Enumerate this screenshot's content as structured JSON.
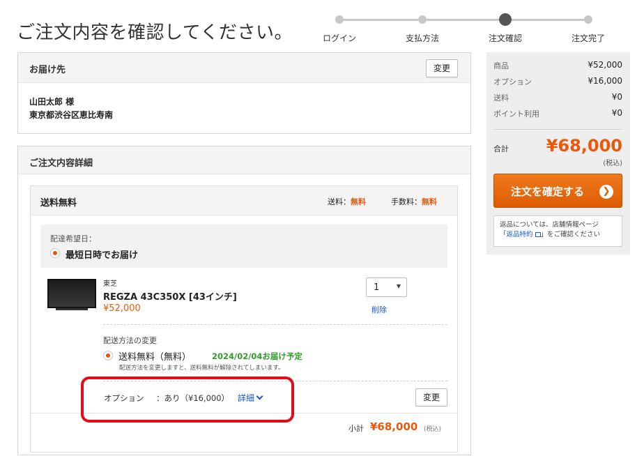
{
  "page_title": "ご注文内容を確認してください。",
  "progress": {
    "steps": [
      "ログイン",
      "支払方法",
      "注文確認",
      "注文完了"
    ],
    "current_index": 2
  },
  "delivery_address": {
    "title": "お届け先",
    "change_label": "変更",
    "name": "山田太郎 様",
    "address": "東京都渋谷区恵比寿南"
  },
  "order_detail": {
    "title": "ご注文内容詳細",
    "shipping_group": {
      "title": "送料無料",
      "shipping_fee_label": "送料：",
      "shipping_fee_value": "無料",
      "handling_fee_label": "手数料：",
      "handling_fee_value": "無料",
      "delivery_date_label": "配達希望日：",
      "delivery_date_option": "最短日時でお届け"
    },
    "item": {
      "brand": "東芝",
      "name": "REGZA 43C350X [43インチ]",
      "price": "¥52,000",
      "quantity": "1",
      "delete_label": "削除"
    },
    "shipping_method": {
      "label": "配送方法の変更",
      "option": "送料無料（無料）",
      "eta": "2024/02/04お届け予定",
      "note": "配送方法を変更しますと、送料無料が解除されてしまいます。"
    },
    "option_row": {
      "label": "オプション",
      "value": "：あり（¥16,000）",
      "detail_link": "詳細",
      "change_label": "変更"
    },
    "subtotal": {
      "label": "小計",
      "value": "¥68,000",
      "tax_note": "(税込)"
    }
  },
  "summary": {
    "rows": [
      {
        "label": "商品",
        "value": "¥52,000"
      },
      {
        "label": "オプション",
        "value": "¥16,000"
      },
      {
        "label": "送料",
        "value": "¥0"
      },
      {
        "label": "ポイント利用",
        "value": "¥0"
      }
    ],
    "total_label": "合計",
    "total_value": "¥68,000",
    "total_tax_note": "(税込)",
    "confirm_button": "注文を確定する",
    "note_text_1": "返品については、店舗情報ページ",
    "note_link": "「返品特約",
    "note_text_2": "」をご確認ください"
  },
  "colors": {
    "accent_orange": "#e8590c",
    "eta_green": "#2e9e25",
    "link_blue": "#1a56c8",
    "highlight_red": "#e50b16"
  }
}
